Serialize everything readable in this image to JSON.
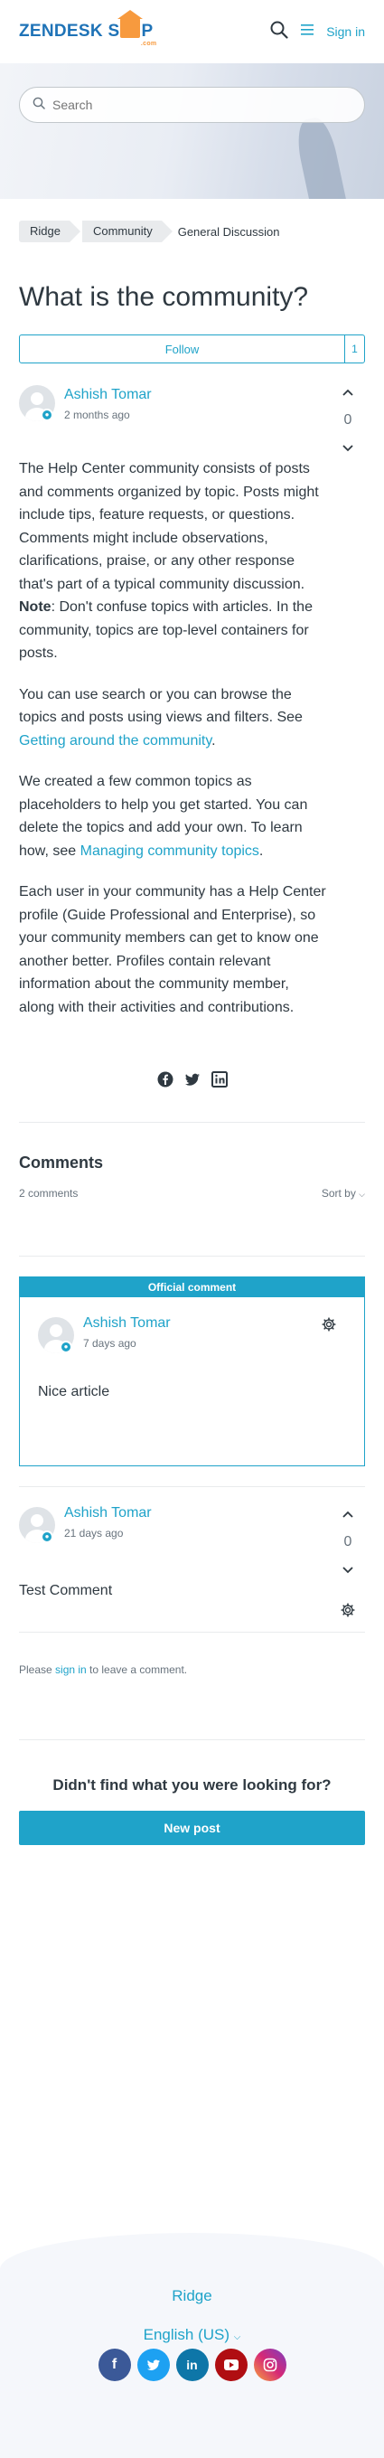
{
  "header": {
    "logo_part1": "ZENDESK S",
    "logo_part2": "P",
    "logo_sub": ".com",
    "signin_label": "Sign in"
  },
  "search": {
    "placeholder": "Search"
  },
  "breadcrumbs": [
    "Ridge",
    "Community",
    "General Discussion"
  ],
  "post": {
    "title": "What is the community?",
    "follow_label": "Follow",
    "follow_count": "1",
    "author": "Ashish Tomar",
    "time": "2 months ago",
    "votes": "0",
    "paragraphs": {
      "p1_start": "The Help Center community consists of posts and comments organized by topic. Posts might include tips, feature requests, or questions. Comments might include observations, clarifications, praise, or any other response that's part of a typical community discussion. ",
      "p1_note": "Note",
      "p1_end": ": Don't confuse topics with articles. In the community, topics are top-level containers for posts.",
      "p2_start": "You can use search or you can browse the topics and posts using views and filters. See ",
      "p2_link": "Getting around the community",
      "p2_end": ".",
      "p3_start": "We created a few common topics as placeholders to help you get started. You can delete the topics and add your own. To learn how, see ",
      "p3_link": "Managing community topics",
      "p3_end": ".",
      "p4": "Each user in your community has a Help Center profile (Guide Professional and Enterprise), so your community members can get to know one another better. Profiles contain relevant information about the community member, along with their activities and contributions."
    }
  },
  "comments": {
    "title": "Comments",
    "count_label": "2 comments",
    "sort_label": "Sort by",
    "official_label": "Official comment",
    "items": [
      {
        "author": "Ashish Tomar",
        "time": "7 days ago",
        "text": "Nice article"
      },
      {
        "author": "Ashish Tomar",
        "time": "21 days ago",
        "text": "Test Comment",
        "votes": "0"
      }
    ],
    "please_start": "Please ",
    "please_link": "sign in",
    "please_end": " to leave a comment."
  },
  "cta": {
    "question": "Didn't find what you were looking for?",
    "button": "New post"
  },
  "footer": {
    "brand": "Ridge",
    "language": "English (US)",
    "socials": [
      "facebook-icon",
      "twitter-icon",
      "linkedin-icon",
      "youtube-icon",
      "instagram-icon"
    ]
  },
  "colors": {
    "accent": "#1fa3c9",
    "text": "#2f3941",
    "muted": "#68737d",
    "logo_blue": "#1f73b7",
    "logo_orange": "#f79a3e"
  }
}
